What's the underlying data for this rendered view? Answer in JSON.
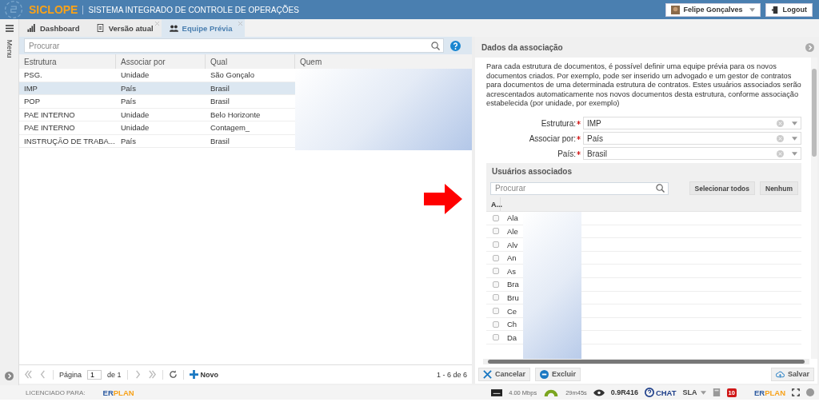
{
  "header": {
    "logo": "SICLOPE",
    "system_name": "SISTEMA INTEGRADO DE CONTROLE DE OPERAÇÕES",
    "user": "Felipe Gonçalves",
    "logout": "Logout"
  },
  "side_menu": {
    "label": "Menu"
  },
  "tabs": [
    {
      "label": "Dashboard",
      "kind": "chart",
      "selected": false,
      "closable": false
    },
    {
      "label": "Versão atual",
      "kind": "document",
      "selected": false,
      "closable": true
    },
    {
      "label": "Equipe Prévia",
      "kind": "team",
      "selected": true,
      "closable": true
    }
  ],
  "list": {
    "search_placeholder": "Procurar",
    "columns": [
      "Estrutura",
      "Associar por",
      "Qual",
      "Quem"
    ],
    "rows": [
      {
        "cells": [
          "PSG.",
          "Unidade",
          "São Gonçalo"
        ],
        "selected": false
      },
      {
        "cells": [
          "IMP",
          "País",
          "Brasil"
        ],
        "selected": true
      },
      {
        "cells": [
          "POP",
          "País",
          "Brasil"
        ],
        "selected": false
      },
      {
        "cells": [
          "PAE INTERNO",
          "Unidade",
          "Belo Horizonte"
        ],
        "selected": false
      },
      {
        "cells": [
          "PAE INTERNO",
          "Unidade",
          "Contagem_"
        ],
        "selected": false
      },
      {
        "cells": [
          "INSTRUÇÃO DE TRABA...",
          "País",
          "Brasil"
        ],
        "selected": false
      }
    ]
  },
  "pager": {
    "page_label": "Página",
    "page": "1",
    "of": "de 1",
    "new": "Novo",
    "range": "1 - 6 de 6"
  },
  "detail": {
    "title": "Dados da associação",
    "description": "Para cada estrutura de documentos, é possível definir uma equipe prévia para os novos documentos criados. Por exemplo, pode ser inserido um advogado e um gestor de contratos para documentos de uma determinada estrutura de contratos. Estes usuários associados serão acrescentados automaticamente nos novos documentos desta estrutura, conforme associação estabelecida (por unidade, por exemplo)",
    "fields": [
      {
        "label": "Estrutura:",
        "value": "IMP",
        "required": true
      },
      {
        "label": "Associar por:",
        "value": "País",
        "required": true
      },
      {
        "label": "País:",
        "value": "Brasil",
        "required": true
      }
    ],
    "users": {
      "title": "Usuários associados",
      "search_placeholder": "Procurar",
      "select_all": "Selecionar todos",
      "none": "Nenhum",
      "column": "A...",
      "rows": [
        {
          "name": "Ala",
          "checked": false
        },
        {
          "name": "Ale",
          "checked": false
        },
        {
          "name": "Alv",
          "checked": false
        },
        {
          "name": "An",
          "checked": false
        },
        {
          "name": "As",
          "checked": false
        },
        {
          "name": "Bra",
          "checked": false
        },
        {
          "name": "Bru",
          "checked": false
        },
        {
          "name": "Ce",
          "checked": false
        },
        {
          "name": "Ch",
          "checked": false
        },
        {
          "name": "Da",
          "checked": false
        }
      ]
    },
    "buttons": {
      "cancel": "Cancelar",
      "delete": "Excluir",
      "save": "Salvar"
    }
  },
  "status_bar": {
    "licensed": "LICENCIADO PARA:",
    "licensee_logo": [
      "ER",
      "PLAN"
    ],
    "vendor_logo": [
      "ER",
      "PLAN"
    ],
    "speed": "4.00 Mbps",
    "time": "29m45s",
    "version": "0.9R416",
    "chat": "CHAT",
    "sla": "SLA",
    "badge": "10"
  }
}
